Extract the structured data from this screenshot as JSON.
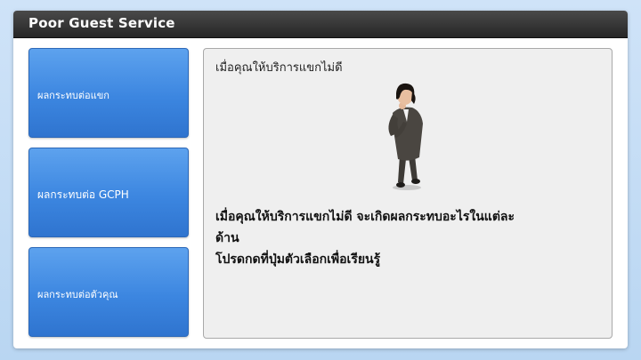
{
  "header": {
    "title": "Poor Guest Service"
  },
  "nav": {
    "items": [
      {
        "label": "ผลกระทบต่อแขก"
      },
      {
        "label": "ผลกระทบต่อ GCPH"
      },
      {
        "label": "ผลกระทบต่อตัวคุณ"
      }
    ]
  },
  "content": {
    "heading": "เมื่อคุณให้บริการแขกไม่ดี",
    "image_icon": "businesswoman-thinking-icon",
    "body_line1": "เมื่อคุณให้บริการแขกไม่ดี จะเกิดผลกระทบอะไรในแต่ละ",
    "body_line2": "ด้าน",
    "body_line3": "โปรดกดที่ปุ่มตัวเลือกเพื่อเรียนรู้"
  },
  "colors": {
    "title_bar": "#2f2f2f",
    "button_blue": "#3c86e0",
    "content_bg": "#efefef",
    "page_bg": "#c4dcf5"
  }
}
